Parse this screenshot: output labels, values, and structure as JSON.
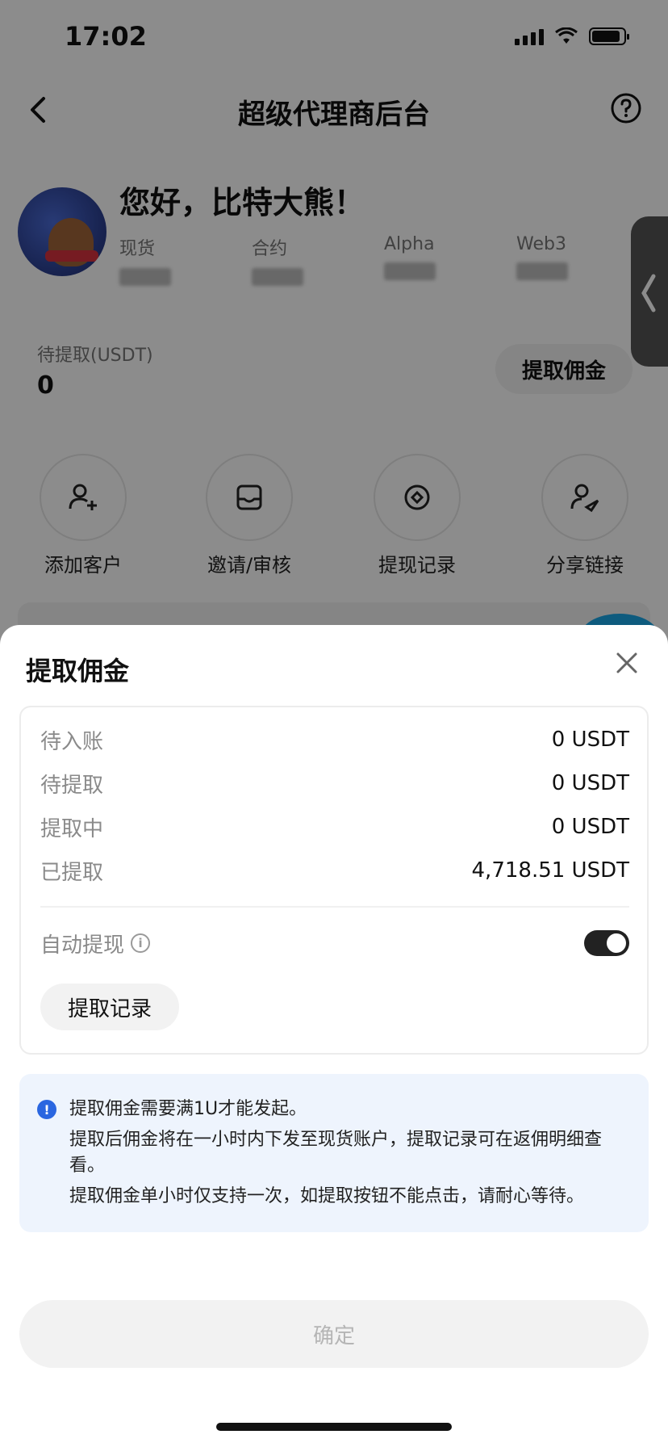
{
  "status_bar": {
    "time": "17:02"
  },
  "nav": {
    "title": "超级代理商后台"
  },
  "profile": {
    "greeting": "您好，比特大熊！",
    "categories": [
      {
        "label": "现货"
      },
      {
        "label": "合约"
      },
      {
        "label": "Alpha"
      },
      {
        "label": "Web3"
      }
    ]
  },
  "pending": {
    "label": "待提取(USDT)",
    "value": "0",
    "button": "提取佣金"
  },
  "quick_actions": [
    {
      "label": "添加客户",
      "icon": "add-user-icon"
    },
    {
      "label": "邀请/审核",
      "icon": "inbox-icon"
    },
    {
      "label": "提现记录",
      "icon": "record-icon"
    },
    {
      "label": "分享链接",
      "icon": "share-icon"
    }
  ],
  "sheet": {
    "title": "提取佣金",
    "rows": [
      {
        "label": "待入账",
        "value": "0 USDT"
      },
      {
        "label": "待提取",
        "value": "0 USDT"
      },
      {
        "label": "提取中",
        "value": "0 USDT"
      },
      {
        "label": "已提取",
        "value": "4,718.51 USDT"
      }
    ],
    "auto_withdraw": {
      "label": "自动提现",
      "enabled": true
    },
    "records_button": "提取记录",
    "notice": [
      "提取佣金需要满1U才能发起。",
      "提取后佣金将在一小时内下发至现货账户，提取记录可在返佣明细查看。",
      "提取佣金单小时仅支持一次，如提取按钮不能点击，请耐心等待。"
    ],
    "confirm_button": "确定"
  }
}
